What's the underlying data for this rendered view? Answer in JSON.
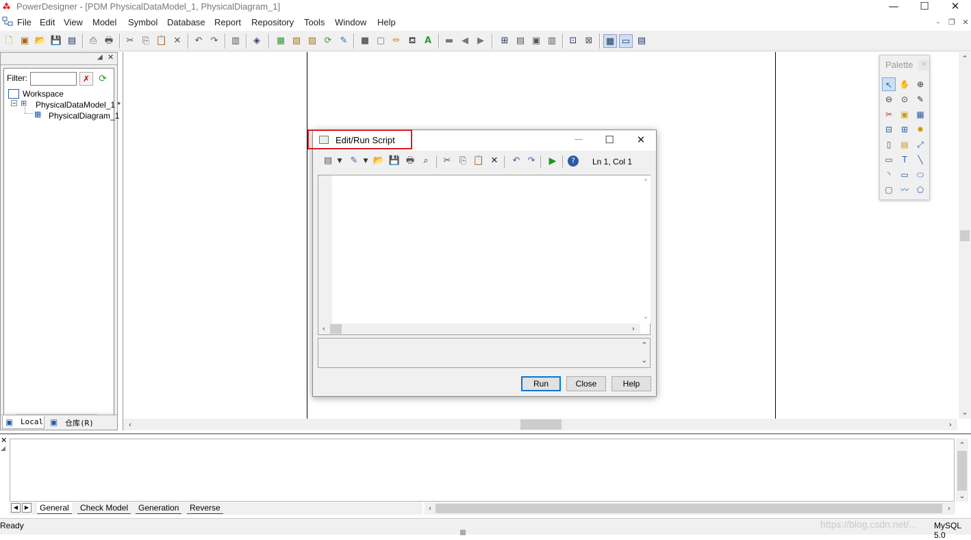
{
  "window": {
    "title": "PowerDesigner - [PDM PhysicalDataModel_1, PhysicalDiagram_1]",
    "min": "—",
    "max": "☐",
    "close": "✕"
  },
  "menu": {
    "items": [
      "File",
      "Edit",
      "View",
      "Model",
      "Symbol",
      "Database",
      "Report",
      "Repository",
      "Tools",
      "Window",
      "Help"
    ]
  },
  "browser": {
    "filter_label": "Filter:",
    "filter_value": "",
    "tree": {
      "workspace": "Workspace",
      "model": "PhysicalDataModel_1 *",
      "diagram": "PhysicalDiagram_1"
    },
    "tabs": {
      "local": "Local",
      "repository": "仓库(R)"
    }
  },
  "palette": {
    "title": "Palette",
    "icons": [
      "pointer-icon",
      "hand-icon",
      "zoom-in-icon",
      "zoom-out-icon",
      "zoom-icon",
      "properties-icon",
      "cut-icon",
      "package-icon",
      "table-icon",
      "view-icon",
      "reference-icon",
      "procedure-icon",
      "file-icon",
      "note-icon",
      "link-icon",
      "synonym-icon",
      "text-icon",
      "line-icon",
      "arc-icon",
      "rectangle-icon",
      "ellipse-icon",
      "rounded-rect-icon",
      "polyline-icon",
      "polygon-icon"
    ]
  },
  "dialog": {
    "title": "Edit/Run Script",
    "cursor_position": "Ln 1, Col 1",
    "editor_text": "",
    "output_text": "",
    "buttons": {
      "run": "Run",
      "close": "Close",
      "help": "Help"
    }
  },
  "output_panel": {
    "tabs": [
      "General",
      "Check Model",
      "Generation",
      "Reverse"
    ]
  },
  "status": {
    "left": "Ready",
    "dbms": "MySQL 5.0",
    "watermark": "https://blog.csdn.net/..."
  }
}
